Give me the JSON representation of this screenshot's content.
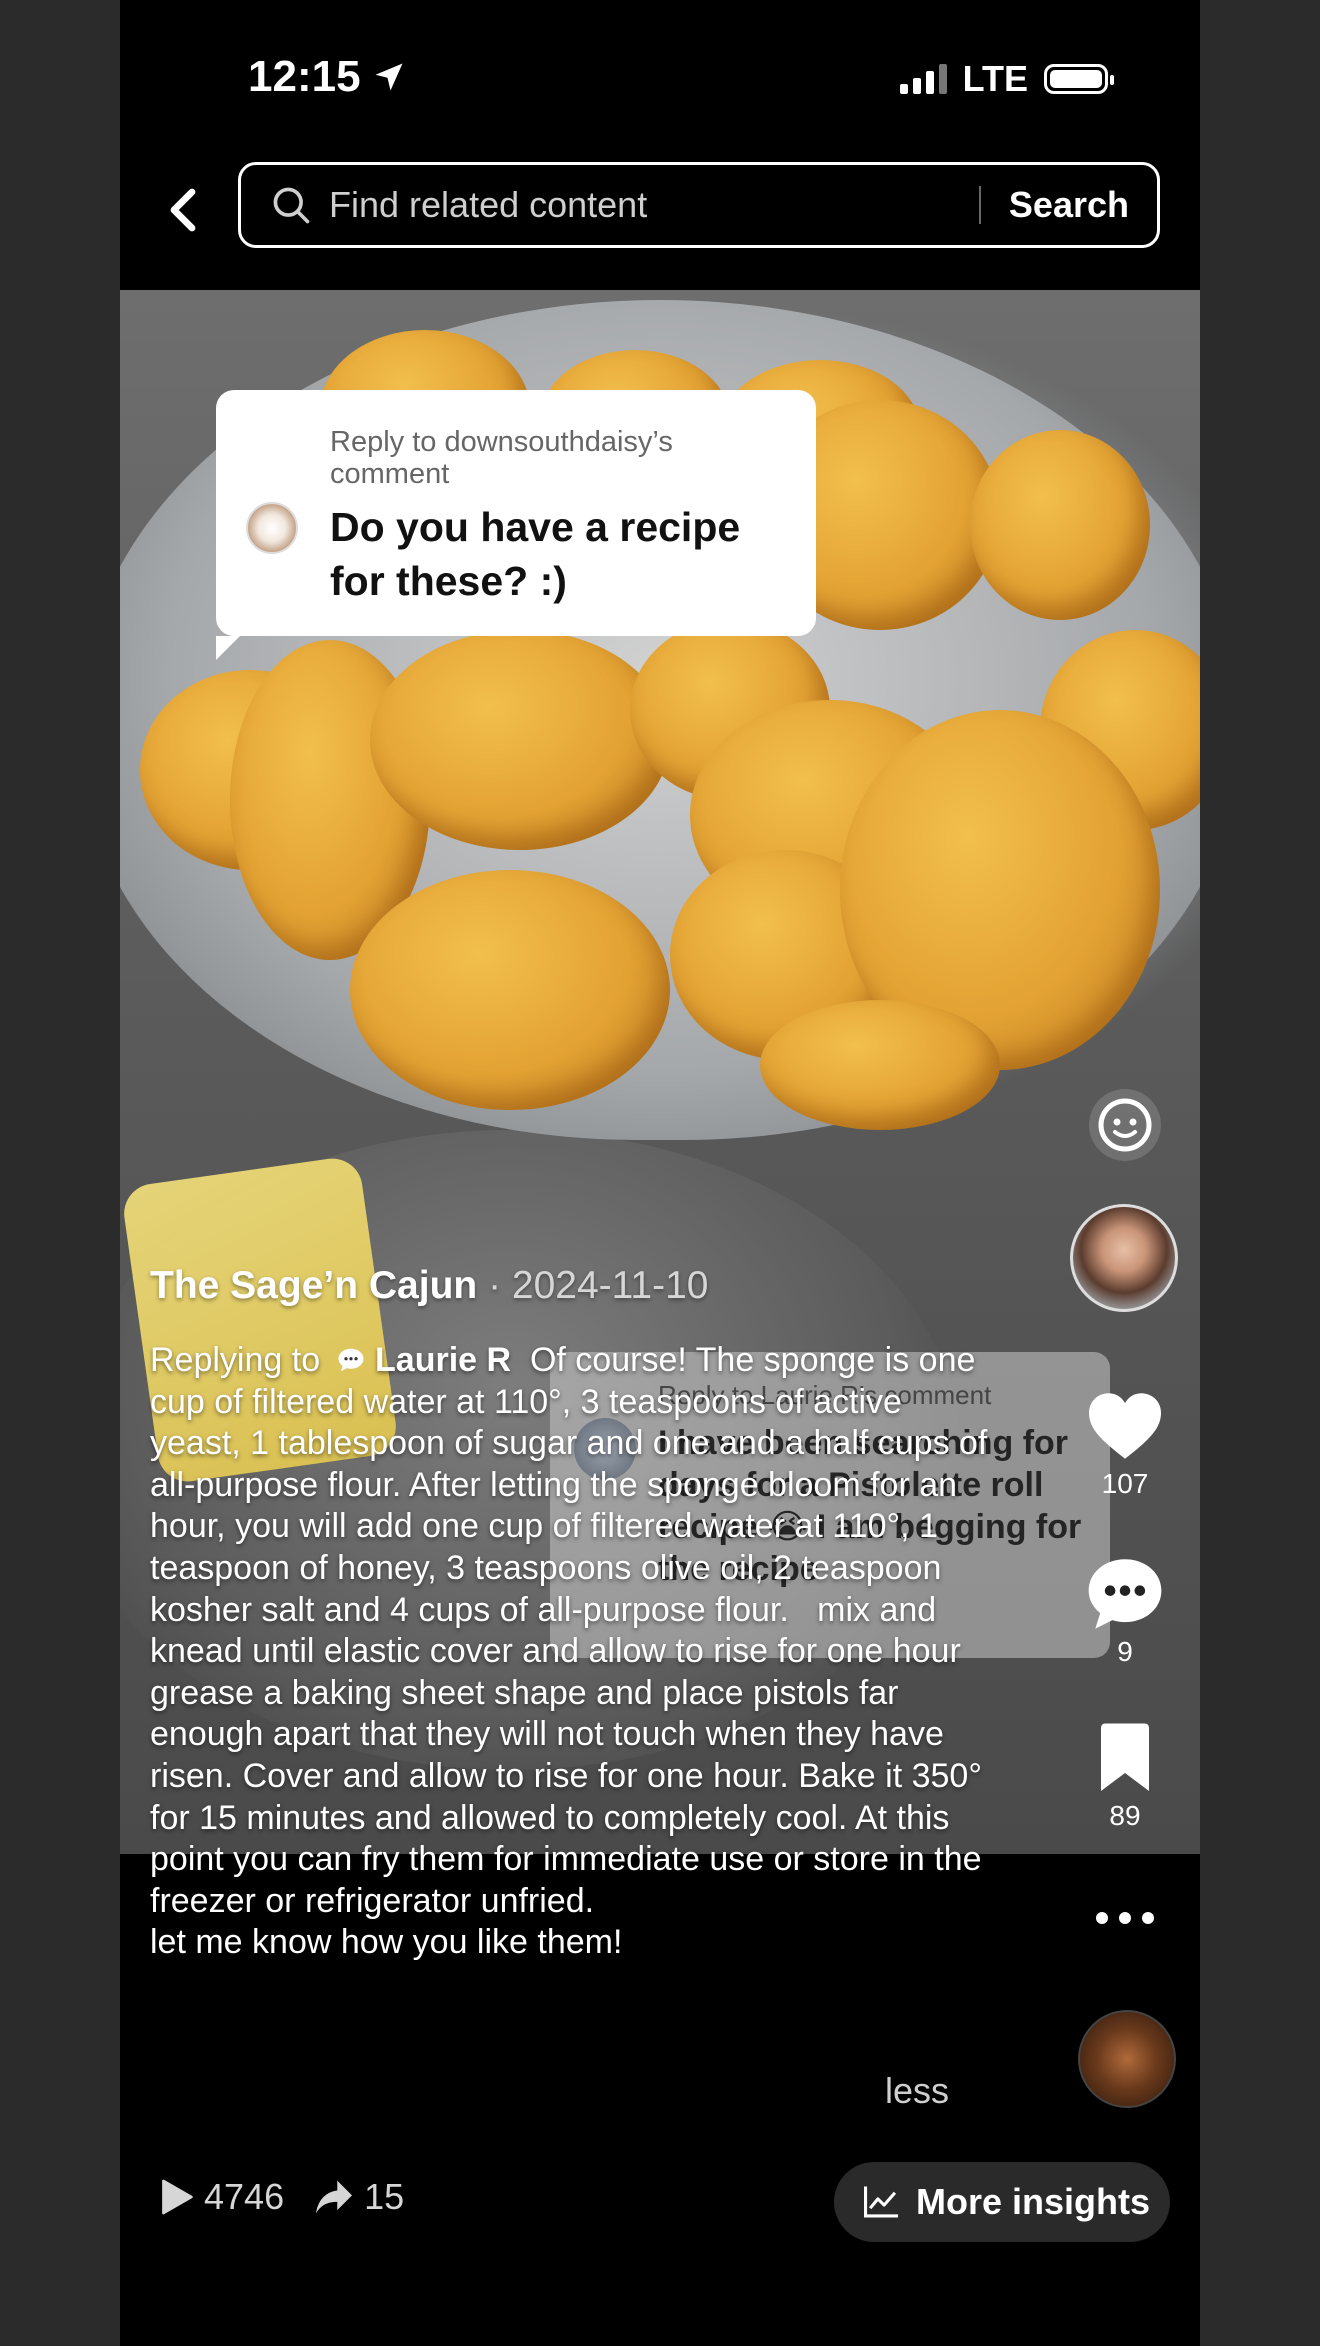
{
  "status_bar": {
    "time": "12:15",
    "network": "LTE"
  },
  "search": {
    "placeholder": "Find related content",
    "button_label": "Search"
  },
  "reply_bubble": {
    "meta": "Reply to downsouthdaisy’s comment",
    "text": "Do you have a recipe for these? :)"
  },
  "overlay_comment": {
    "meta": "Reply to Laurie R’s comment",
    "text": "I have been searching for days for a Pistolette roll recipe 😭 I am begging for the recipe"
  },
  "actions": {
    "likes": "107",
    "comments": "9",
    "saves": "89"
  },
  "caption": {
    "author": "The Sage’n Cajun",
    "date": "· 2024-11-10",
    "replying_prefix": "Replying to",
    "replying_to": "Laurie R",
    "body": "Of course! The sponge is one cup of filtered water at 110°, 3 teaspoons of active yeast, 1 tablespoon of sugar and one and a half cups of all-purpose flour. After letting the sponge bloom for an hour, you will add one cup of filtered water at 110°, 1 teaspoon of honey, 3 teaspoons olive oil, 2 teaspoon kosher salt and 4 cups of all-purpose flour.   mix and knead until elastic cover and allow to rise for one hour grease a baking sheet shape and place pistols far enough apart that they will not touch when they have risen. Cover and allow to rise for one hour. Bake it 350° for 15 minutes and allowed to completely cool. At this point you can fry them for immediate use or store in the freezer or refrigerator unfried.\nlet me know how you like them!",
    "less_label": "less"
  },
  "stats": {
    "plays": "4746",
    "shares": "15"
  },
  "insights": {
    "label": "More insights"
  },
  "colors": {
    "background": "#000000",
    "pill": "#2a2a2a",
    "text": "#ffffff"
  }
}
